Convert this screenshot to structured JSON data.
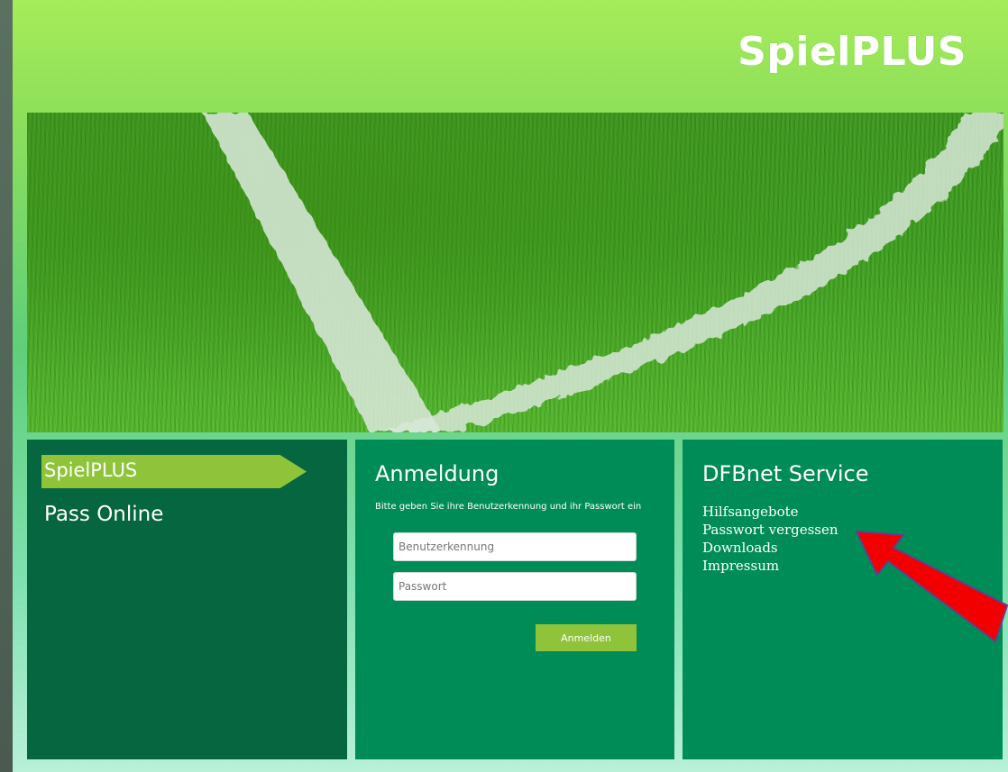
{
  "header": {
    "brand": "SpielPLUS"
  },
  "left_panel": {
    "active_item": "SpielPLUS",
    "item": "Pass Online"
  },
  "login": {
    "title": "Anmeldung",
    "hint": "Bitte geben Sie ihre Benutzerkennung und ihr Passwort ein",
    "username_placeholder": "Benutzerkennung",
    "password_placeholder": "Passwort",
    "submit_label": "Anmelden"
  },
  "service": {
    "title": "DFBnet Service",
    "links": [
      "Hilfsangebote",
      "Passwort vergessen",
      "Downloads",
      "Impressum"
    ]
  },
  "colors": {
    "panel_dark": "#05663f",
    "panel": "#008c57",
    "accent": "#8fc43a",
    "arrow": "#ff0000"
  }
}
